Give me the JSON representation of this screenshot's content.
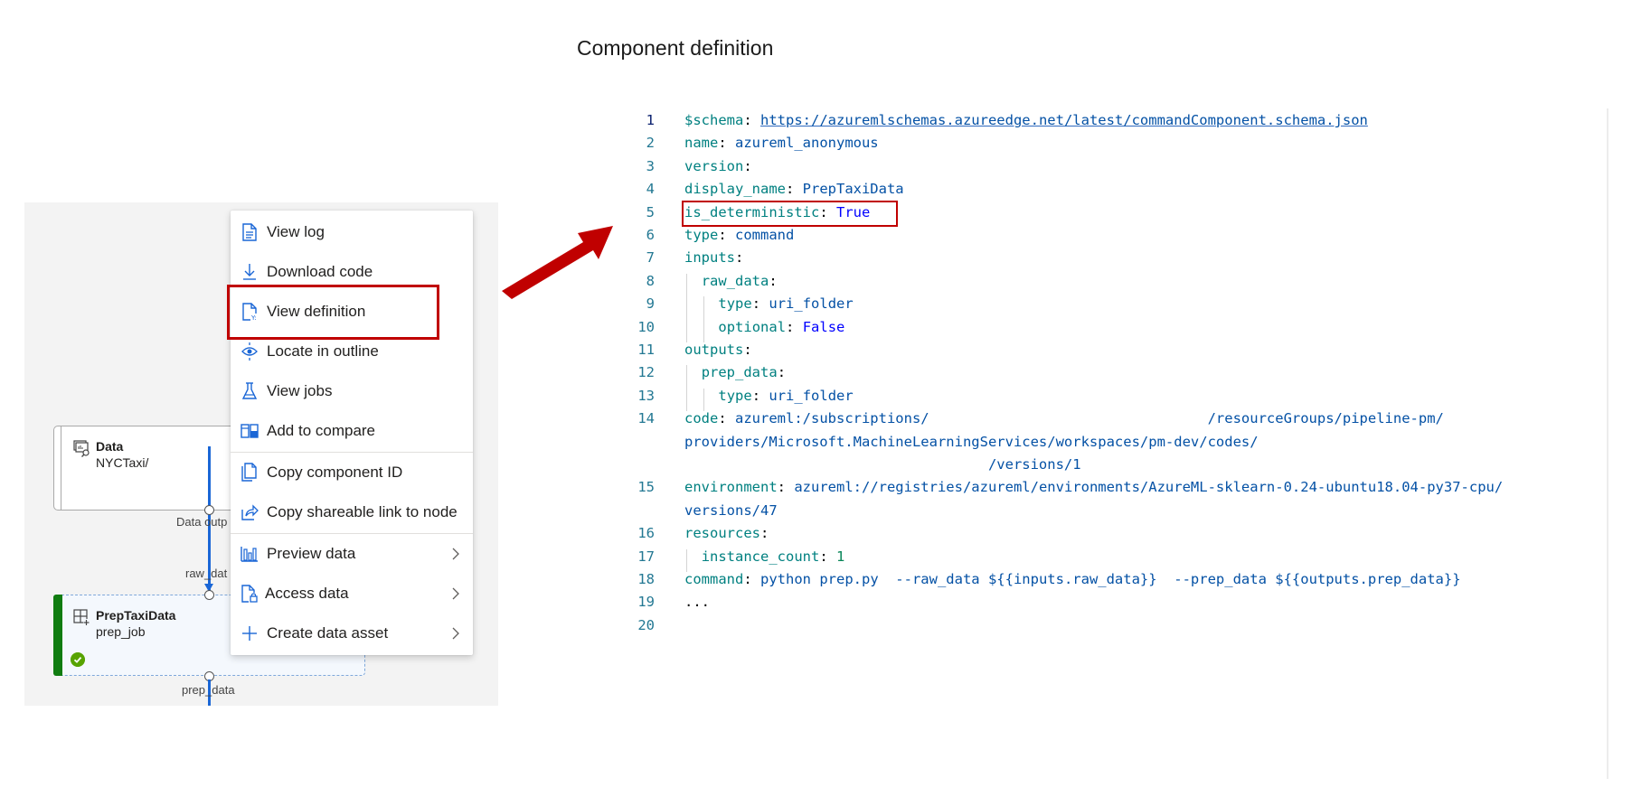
{
  "page": {
    "title": "Component definition"
  },
  "canvas": {
    "data_node": {
      "title": "Data",
      "subtitle": "NYCTaxi/",
      "icon": "dataset-icon",
      "output_port_label": "Data outp"
    },
    "prep_node": {
      "title": "PrepTaxiData",
      "subtitle": "prep_job",
      "icon": "component-icon",
      "status": "completed",
      "input_port_label": "raw_dat",
      "output_port_label": "prep_data",
      "accent_color": "#107c10"
    }
  },
  "context_menu": {
    "items": [
      {
        "label": "View log",
        "icon": "document-icon",
        "has_submenu": false
      },
      {
        "label": "Download code",
        "icon": "download-icon",
        "has_submenu": false
      },
      {
        "label": "View definition",
        "icon": "yaml-file-icon",
        "has_submenu": false,
        "highlighted": true
      },
      {
        "label": "Locate in outline",
        "icon": "locate-icon",
        "has_submenu": false
      },
      {
        "label": "View jobs",
        "icon": "flask-icon",
        "has_submenu": false
      },
      {
        "label": "Add to compare",
        "icon": "compare-icon",
        "has_submenu": false
      },
      {
        "label": "Copy component ID",
        "icon": "copy-icon",
        "has_submenu": false
      },
      {
        "label": "Copy shareable link to node",
        "icon": "share-icon",
        "has_submenu": false
      },
      {
        "label": "Preview data",
        "icon": "chart-icon",
        "has_submenu": true
      },
      {
        "label": "Access data",
        "icon": "file-lock-icon",
        "has_submenu": true
      },
      {
        "label": "Create data asset",
        "icon": "plus-icon",
        "has_submenu": true
      }
    ]
  },
  "annotation": {
    "highlight_color": "#c00000"
  },
  "code": {
    "lines": [
      {
        "n": "1",
        "key": "$schema",
        "value": "https://azuremlschemas.azureedge.net/latest/commandComponent.schema.json",
        "kind": "link"
      },
      {
        "n": "2",
        "key": "name",
        "value": "azureml_anonymous",
        "kind": "s"
      },
      {
        "n": "3",
        "key": "version",
        "value": "",
        "kind": "s"
      },
      {
        "n": "4",
        "key": "display_name",
        "value": "PrepTaxiData",
        "kind": "s"
      },
      {
        "n": "5",
        "key": "is_deterministic",
        "value": "True",
        "kind": "b",
        "highlighted": true
      },
      {
        "n": "6",
        "key": "type",
        "value": "command",
        "kind": "s"
      },
      {
        "n": "7",
        "key": "inputs",
        "value": "",
        "kind": "s"
      },
      {
        "n": "8",
        "key": "raw_data",
        "value": "",
        "kind": "s",
        "indent": 1
      },
      {
        "n": "9",
        "key": "type",
        "value": "uri_folder",
        "kind": "s",
        "indent": 2
      },
      {
        "n": "10",
        "key": "optional",
        "value": "False",
        "kind": "b",
        "indent": 2
      },
      {
        "n": "11",
        "key": "outputs",
        "value": "",
        "kind": "s"
      },
      {
        "n": "12",
        "key": "prep_data",
        "value": "",
        "kind": "s",
        "indent": 1
      },
      {
        "n": "13",
        "key": "type",
        "value": "uri_folder",
        "kind": "s",
        "indent": 2
      },
      {
        "n": "14",
        "key": "code",
        "value": "azureml:/subscriptions/                                 /resourceGroups/pipeline-pm/",
        "kind": "s",
        "wrap": [
          "providers/Microsoft.MachineLearningServices/workspaces/pm-dev/codes/",
          "                                    /versions/1"
        ]
      },
      {
        "n": "15",
        "key": "environment",
        "value": "azureml://registries/azureml/environments/AzureML-sklearn-0.24-ubuntu18.04-py37-cpu/",
        "kind": "s",
        "wrap": [
          "versions/47"
        ]
      },
      {
        "n": "16",
        "key": "resources",
        "value": "",
        "kind": "s"
      },
      {
        "n": "17",
        "key": "instance_count",
        "value": "1",
        "kind": "n",
        "indent": 1
      },
      {
        "n": "18",
        "key": "command",
        "value": "python prep.py  --raw_data ${{inputs.raw_data}}  --prep_data ${{outputs.prep_data}}",
        "kind": "s"
      },
      {
        "n": "19",
        "key": "",
        "value": "...",
        "kind": "plain"
      },
      {
        "n": "20",
        "key": "",
        "value": "",
        "kind": "plain"
      }
    ]
  }
}
